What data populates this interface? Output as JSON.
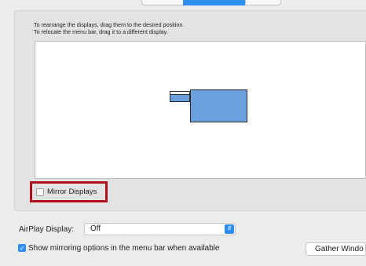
{
  "instructions": {
    "line1": "To rearrange the displays, drag them to the desired position.",
    "line2": "To relocate the menu bar, drag it to a different display."
  },
  "mirror": {
    "label": "Mirror Displays",
    "checked": false
  },
  "airplay": {
    "label": "AirPlay Display:",
    "value": "Off"
  },
  "show_mirroring": {
    "label": "Show mirroring options in the menu bar when available",
    "checked": true
  },
  "gather_button": {
    "label": "Gather Windo"
  },
  "colors": {
    "accent": "#2e8ef6",
    "highlight": "#b0101a",
    "display_fill": "#6aa1dc"
  }
}
